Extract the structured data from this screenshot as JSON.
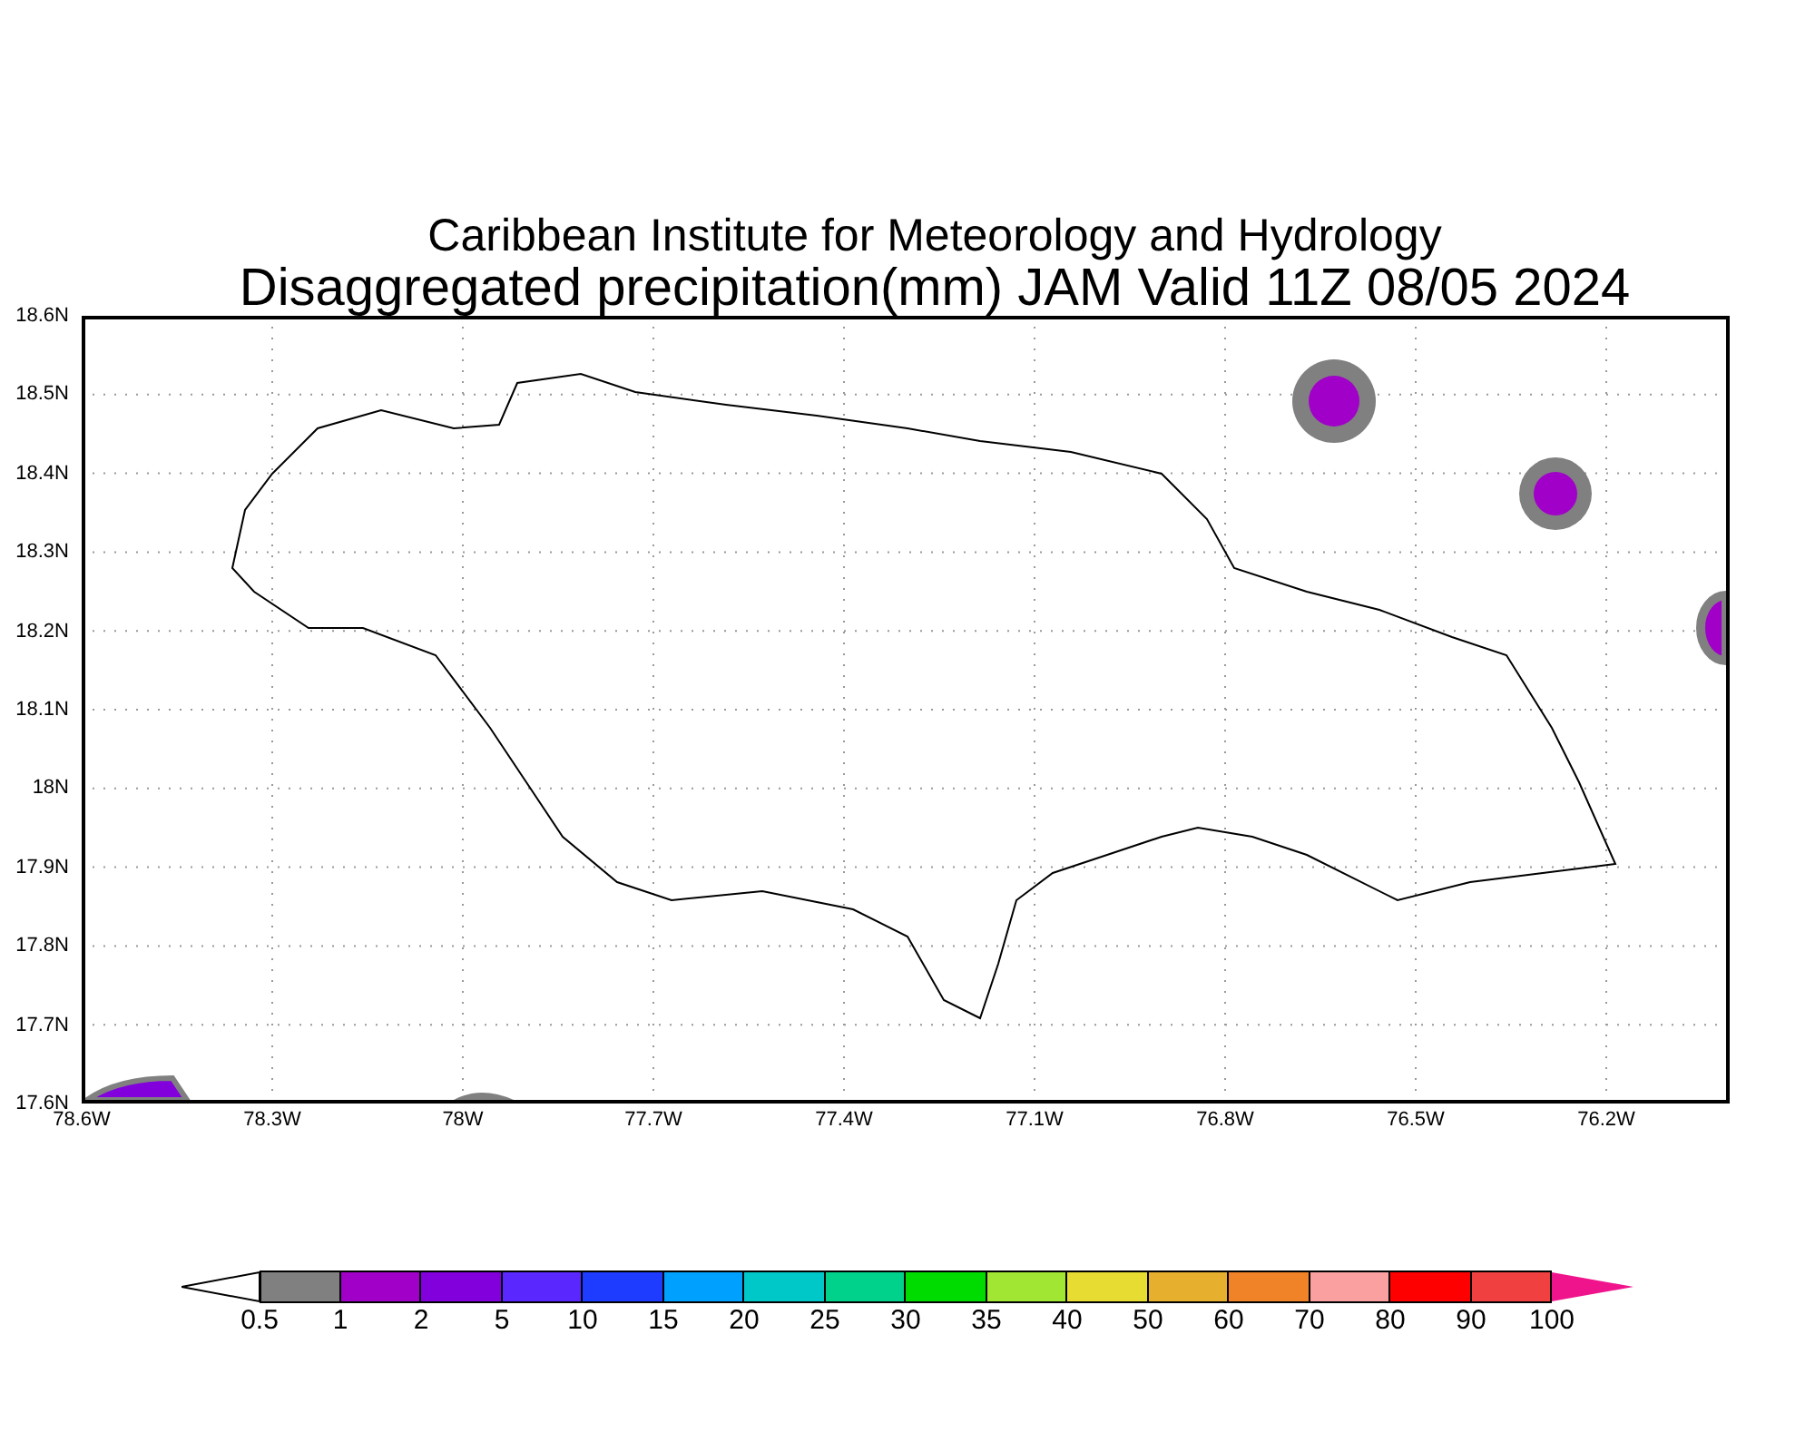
{
  "title": {
    "lines": [
      "Caribbean Institute for Meteorology and Hydrology",
      "Disaggregated precipitation(mm) JAM Valid 11Z 08/05 2024"
    ]
  },
  "map": {
    "y_labels": [
      "18.6N",
      "18.5N",
      "18.4N",
      "18.3N",
      "18.2N",
      "18.1N",
      "18N",
      "17.9N",
      "17.8N",
      "17.7N",
      "17.6N"
    ],
    "x_labels": [
      "78.6W",
      "78.3W",
      "78W",
      "77.7W",
      "77.4W",
      "77.1W",
      "76.8W",
      "76.5W",
      "76.2W"
    ]
  },
  "colorbar": {
    "ends": [
      {
        "kind": "below",
        "color": "#ffffff"
      },
      {
        "kind": "above",
        "color": "#f0148c"
      }
    ],
    "segments": [
      {
        "color": "#808080"
      },
      {
        "color": "#a000c8"
      },
      {
        "color": "#8200dc"
      },
      {
        "color": "#5a28ff"
      },
      {
        "color": "#1e3cff"
      },
      {
        "color": "#00a0ff"
      },
      {
        "color": "#00c8c8"
      },
      {
        "color": "#00d28c"
      },
      {
        "color": "#00dc00"
      },
      {
        "color": "#a0e632"
      },
      {
        "color": "#e6dc32"
      },
      {
        "color": "#e6af2d"
      },
      {
        "color": "#f08228"
      },
      {
        "color": "#faa0a0"
      },
      {
        "color": "#ff0000"
      },
      {
        "color": "#f04040"
      }
    ],
    "labels": [
      "0.5",
      "1",
      "2",
      "5",
      "10",
      "15",
      "20",
      "25",
      "30",
      "35",
      "40",
      "50",
      "60",
      "70",
      "80",
      "90",
      "100"
    ]
  }
}
